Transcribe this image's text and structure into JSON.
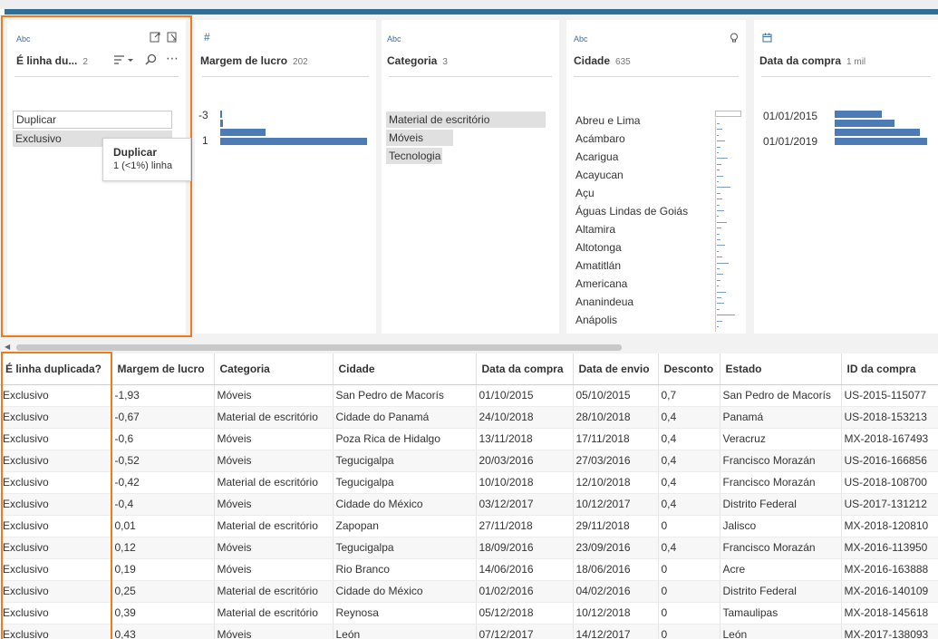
{
  "cards": [
    {
      "type": "Abc",
      "title": "É linha du...",
      "count": "2"
    },
    {
      "type": "#",
      "title": "Margem de lucro",
      "count": "202"
    },
    {
      "type": "Abc",
      "title": "Categoria",
      "count": "3"
    },
    {
      "type": "Abc",
      "title": "Cidade",
      "count": "635"
    },
    {
      "type": "",
      "title": "Data da compra",
      "count": "1 mil"
    }
  ],
  "duplicada": {
    "values": [
      "Duplicar",
      "Exclusivo"
    ]
  },
  "tooltip": {
    "title": "Duplicar",
    "sub": "1 (<1%) linha"
  },
  "margem": {
    "labels": [
      "-3",
      "1"
    ],
    "bins": [
      0.01,
      0.02,
      0.31,
      1.0
    ]
  },
  "categoria": {
    "values": [
      "Material de escritório",
      "Móveis",
      "Tecnologia"
    ],
    "shares": [
      1.0,
      0.42,
      0.35
    ]
  },
  "cidade": {
    "values": [
      "Abreu e Lima",
      "Acámbaro",
      "Acarigua",
      "Acayucan",
      "Açu",
      "Águas Lindas de Goiás",
      "Altamira",
      "Altotonga",
      "Amatitlán",
      "Americana",
      "Ananindeua",
      "Anápolis"
    ]
  },
  "data": {
    "labels": [
      "01/01/2015",
      "01/01/2019"
    ],
    "bins": [
      0.51,
      0.65,
      0.92,
      1.0
    ]
  },
  "columns": [
    "É linha duplicada?",
    "Margem de lucro",
    "Categoria",
    "Cidade",
    "Data da compra",
    "Data de envio",
    "Desconto",
    "Estado",
    "ID da compra"
  ],
  "rows": [
    [
      "Exclusivo",
      "-1,93",
      "Móveis",
      "San Pedro de Macorís",
      "01/10/2015",
      "05/10/2015",
      "0,7",
      "San Pedro de Macorís",
      "US-2015-115077"
    ],
    [
      "Exclusivo",
      "-0,67",
      "Material de escritório",
      "Cidade do Panamá",
      "24/10/2018",
      "28/10/2018",
      "0,4",
      "Panamá",
      "US-2018-153213"
    ],
    [
      "Exclusivo",
      "-0,6",
      "Móveis",
      "Poza Rica de Hidalgo",
      "13/11/2018",
      "17/11/2018",
      "0,4",
      "Veracruz",
      "MX-2018-167493"
    ],
    [
      "Exclusivo",
      "-0,52",
      "Móveis",
      "Tegucigalpa",
      "20/03/2016",
      "27/03/2016",
      "0,4",
      "Francisco Morazán",
      "US-2016-166856"
    ],
    [
      "Exclusivo",
      "-0,42",
      "Material de escritório",
      "Tegucigalpa",
      "10/10/2018",
      "12/10/2018",
      "0,4",
      "Francisco Morazán",
      "US-2018-108700"
    ],
    [
      "Exclusivo",
      "-0,4",
      "Móveis",
      "Cidade do México",
      "03/12/2017",
      "10/12/2017",
      "0,4",
      "Distrito Federal",
      "US-2017-131212"
    ],
    [
      "Exclusivo",
      "0,01",
      "Material de escritório",
      "Zapopan",
      "27/11/2018",
      "29/11/2018",
      "0",
      "Jalisco",
      "MX-2018-120810"
    ],
    [
      "Exclusivo",
      "0,12",
      "Móveis",
      "Tegucigalpa",
      "18/09/2016",
      "23/09/2016",
      "0,4",
      "Francisco Morazán",
      "MX-2016-113950"
    ],
    [
      "Exclusivo",
      "0,19",
      "Móveis",
      "Rio Branco",
      "14/06/2016",
      "18/06/2016",
      "0",
      "Acre",
      "MX-2016-163888"
    ],
    [
      "Exclusivo",
      "0,25",
      "Material de escritório",
      "Cidade do México",
      "01/02/2016",
      "04/02/2016",
      "0",
      "Distrito Federal",
      "MX-2016-140109"
    ],
    [
      "Exclusivo",
      "0,39",
      "Material de escritório",
      "Reynosa",
      "05/12/2018",
      "10/12/2018",
      "0",
      "Tamaulipas",
      "MX-2018-145618"
    ],
    [
      "Exclusivo",
      "0,43",
      "Móveis",
      "León",
      "07/12/2017",
      "14/12/2017",
      "0",
      "León",
      "MX-2017-138093"
    ]
  ],
  "colors": {
    "accent": "#f07b1d",
    "bar": "#4d7bb5",
    "topline": "#2f6e99"
  }
}
